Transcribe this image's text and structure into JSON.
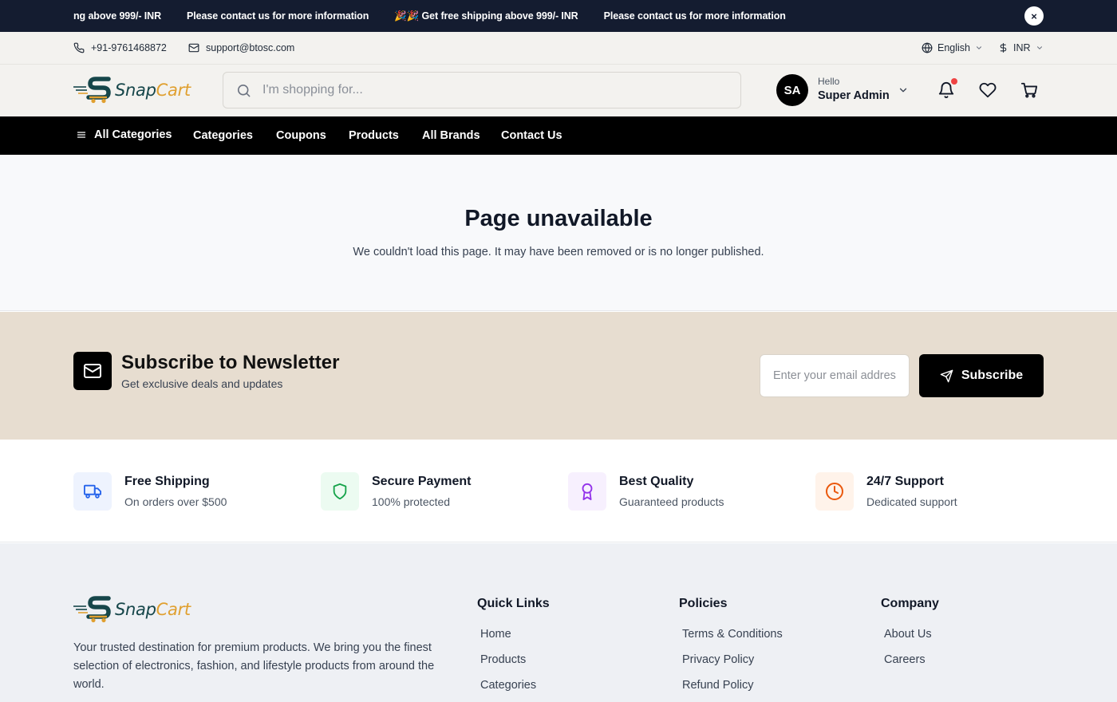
{
  "announcement": {
    "messages": [
      "ng above 999/- INR",
      "Please contact us for more information",
      "🎉🎉 Get free shipping above 999/- INR",
      "Please contact us for more information"
    ],
    "close_label": "×"
  },
  "contact": {
    "phone": "+91-9761468872",
    "email": "support@btosc.com",
    "language": "English",
    "currency": "INR"
  },
  "brand": {
    "name_part1": "Snap",
    "name_part2": "Cart"
  },
  "search": {
    "placeholder": "I'm shopping for..."
  },
  "user": {
    "initials": "SA",
    "greeting": "Hello",
    "name": "Super Admin"
  },
  "nav": {
    "all_categories": "All Categories",
    "links": [
      "Categories",
      "Coupons",
      "Products",
      "All Brands",
      "Contact Us"
    ]
  },
  "main": {
    "title": "Page unavailable",
    "message": "We couldn't load this page. It may have been removed or is no longer published."
  },
  "newsletter": {
    "title": "Subscribe to Newsletter",
    "subtitle": "Get exclusive deals and updates",
    "placeholder": "Enter your email address",
    "button": "Subscribe"
  },
  "features": [
    {
      "title": "Free Shipping",
      "desc": "On orders over $500",
      "icon": "truck-icon",
      "color": "#2563eb",
      "bg": "#eef3fe"
    },
    {
      "title": "Secure Payment",
      "desc": "100% protected",
      "icon": "shield-icon",
      "color": "#16a34a",
      "bg": "#ecfbf1"
    },
    {
      "title": "Best Quality",
      "desc": "Guaranteed products",
      "icon": "award-icon",
      "color": "#9333ea",
      "bg": "#f7f0fe"
    },
    {
      "title": "24/7 Support",
      "desc": "Dedicated support",
      "icon": "clock-icon",
      "color": "#ea580c",
      "bg": "#fff3ea"
    }
  ],
  "footer": {
    "description": "Your trusted destination for premium products. We bring you the finest selection of electronics, fashion, and lifestyle products from around the world.",
    "quick_links": {
      "title": "Quick Links",
      "items": [
        "Home",
        "Products",
        "Categories"
      ]
    },
    "policies": {
      "title": "Policies",
      "items": [
        "Terms & Conditions",
        "Privacy Policy",
        "Refund Policy"
      ]
    },
    "company": {
      "title": "Company",
      "items": [
        "About Us",
        "Careers"
      ]
    }
  },
  "colors": {
    "announcement_bg": "#141c30",
    "header_bg": "#f3f2ef",
    "nav_bg": "#000000",
    "newsletter_bg": "#e7ddd0",
    "footer_bg": "#eef0f4",
    "brand_dark": "#16464a",
    "brand_gold": "#e0a030",
    "notification_dot": "#ef4444"
  }
}
